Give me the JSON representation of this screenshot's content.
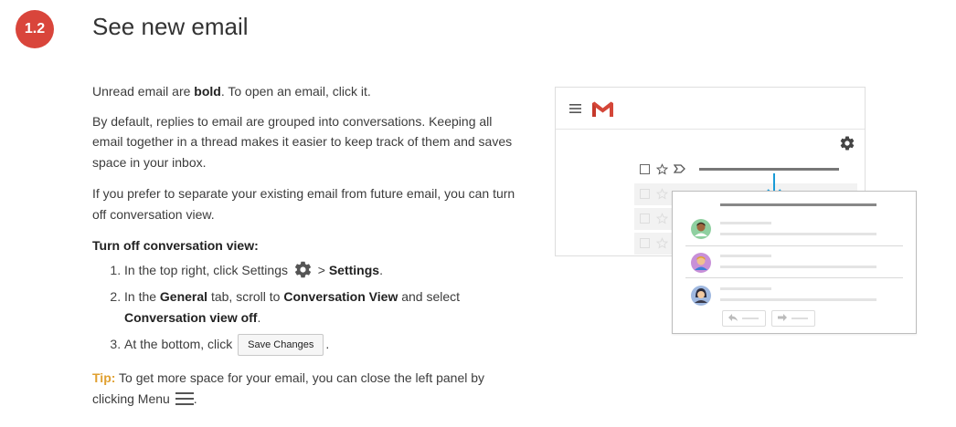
{
  "step": {
    "number": "1.2"
  },
  "page": {
    "title": "See new email"
  },
  "intro": {
    "text_before": "Unread email are ",
    "bold_word": "bold",
    "text_after": ". To open an email, click it."
  },
  "paragraphs": [
    "By default, replies to email are grouped into conversations. Keeping all email together in a thread makes it easier to keep track of them and saves space in your inbox.",
    "If you prefer to separate your existing email from future email, you can turn off conversation view."
  ],
  "instructions": {
    "heading": "Turn off conversation view:",
    "step1": {
      "text_before": "In the top right, click Settings",
      "separator": " > ",
      "settings_label": "Settings",
      "end": "."
    },
    "step2": {
      "text1": "In the ",
      "general": "General",
      "text2": " tab, scroll to ",
      "conversation_view": "Conversation View",
      "text3": " and select ",
      "conversation_view_off": "Conversation view off",
      "end": "."
    },
    "step3": {
      "text_before": "At the bottom, click ",
      "button_label": "Save Changes",
      "end": "."
    }
  },
  "tip": {
    "label": "Tip:",
    "text": " To get more space for your email, you can close the left panel by clicking Menu",
    "end": "."
  },
  "illustration": {
    "icons": [
      "menu-icon",
      "gmail-logo",
      "gear-icon",
      "checkbox-icon",
      "star-icon",
      "important-icon",
      "arrow-down-icon",
      "avatar",
      "reply-icon",
      "forward-icon"
    ],
    "colors": {
      "accent_red": "#d9453b",
      "arrow_blue": "#1a9bd7",
      "tip_yellow": "#e0a030"
    }
  }
}
